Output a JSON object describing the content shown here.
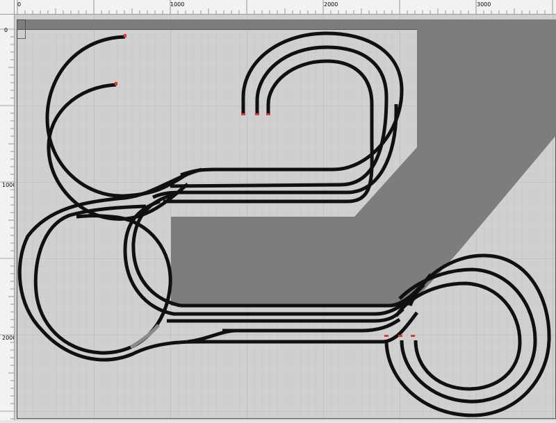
{
  "app": {
    "view": "track-plan-editor"
  },
  "ruler": {
    "h_labels": [
      "0",
      "1000",
      "2000",
      "3000"
    ],
    "v_labels": [
      "0",
      "1000",
      "2000"
    ],
    "units": "mm"
  },
  "colors": {
    "canvas_bg": "#e4e4e4",
    "board": "#d0d0d0",
    "board_border": "#5a5a5a",
    "void": "#7d7d7d",
    "track": "#101010",
    "selected_track": "#8a8a8a",
    "track_end": "#e03a2a",
    "grid_minor": "#c2c2c2",
    "grid_major": "#b5b5b5"
  },
  "legend": {
    "track_ends_marked": "red",
    "selected_piece": "grey"
  }
}
